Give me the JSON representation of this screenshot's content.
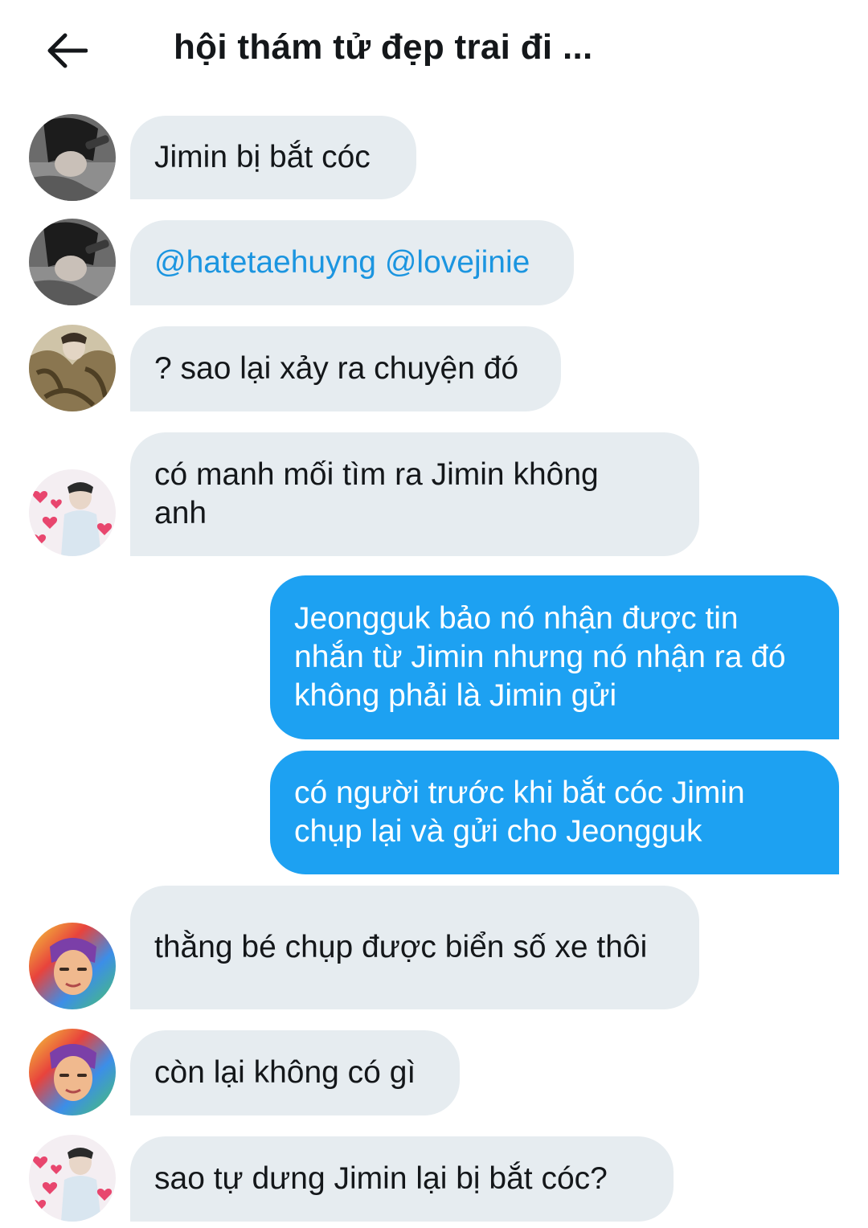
{
  "header": {
    "title": "hội thám tử đẹp trai đi ..."
  },
  "messages": [
    {
      "direction": "in",
      "avatar": "avatar-dark-hair",
      "text": "Jimin bị bắt cóc"
    },
    {
      "direction": "in",
      "avatar": "avatar-dark-hair",
      "mentions": [
        "@hatetaehuyng",
        "@lovejinie"
      ]
    },
    {
      "direction": "in",
      "avatar": "avatar-fur-coat",
      "text": "? sao lại xảy ra chuyện đó"
    },
    {
      "direction": "in",
      "avatar": "avatar-hearts",
      "text": "có manh mối tìm ra Jimin không anh"
    },
    {
      "direction": "out",
      "text": "Jeongguk bảo nó nhận được tin nhắn từ Jimin nhưng nó nhận ra đó không phải là Jimin gửi"
    },
    {
      "direction": "out",
      "text": "có người trước khi bắt cóc Jimin chụp lại và gửi cho Jeongguk"
    },
    {
      "direction": "in",
      "avatar": "avatar-rainbow",
      "text": "thằng bé chụp được biển số xe thôi"
    },
    {
      "direction": "in",
      "avatar": "avatar-rainbow",
      "text": "còn lại không có gì"
    },
    {
      "direction": "in",
      "avatar": "avatar-hearts",
      "text": "sao tự dưng Jimin lại bị bắt cóc?"
    }
  ],
  "colors": {
    "incoming_bubble": "#e6ecf0",
    "outgoing_bubble": "#1da1f2",
    "mention": "#1b95e0",
    "text": "#14171a"
  },
  "icons": {
    "back": "arrow-left-icon"
  }
}
